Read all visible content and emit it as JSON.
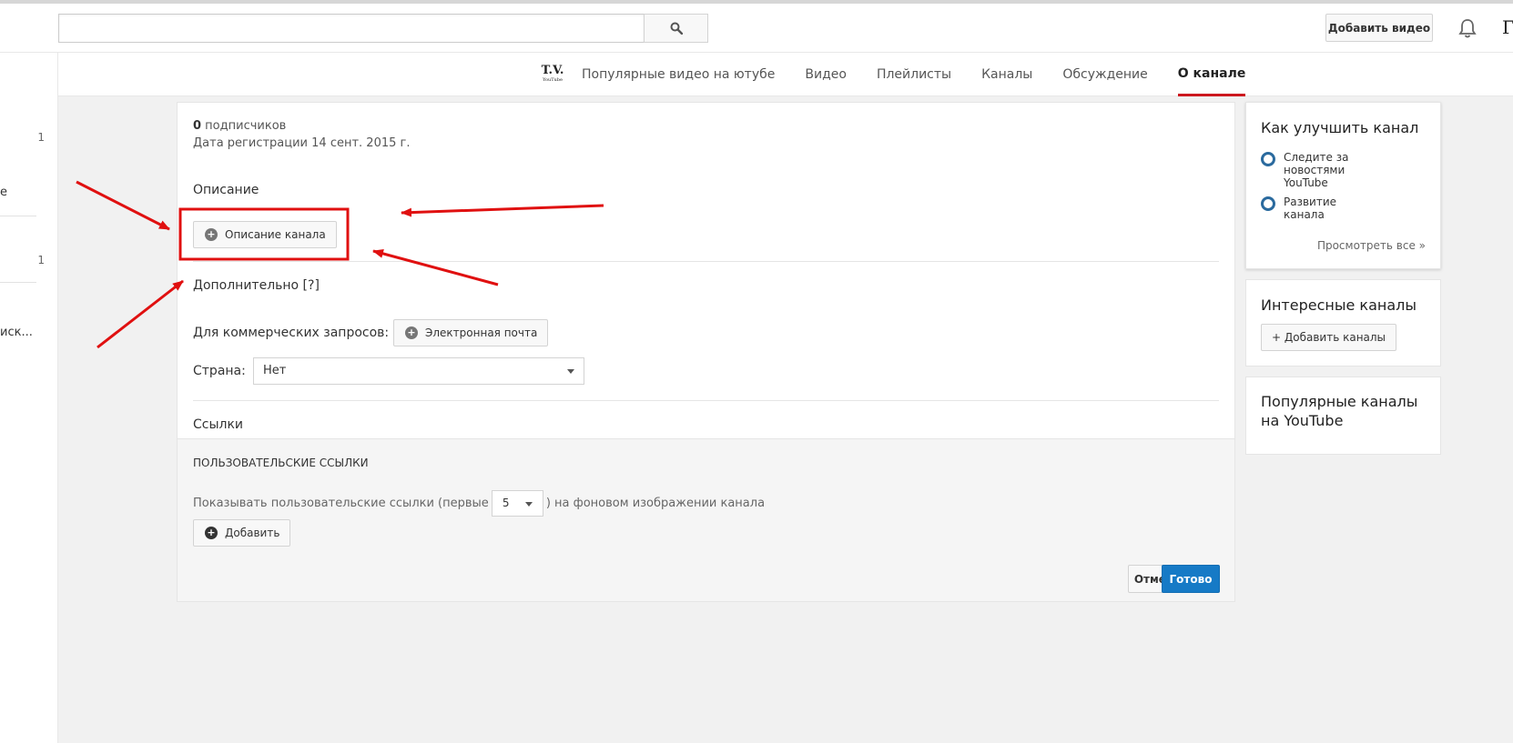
{
  "header": {
    "search": {
      "value": "",
      "placeholder": ""
    },
    "upload_label": "Добавить видео",
    "avatar_letter": "Г"
  },
  "leftnav": {
    "items": [
      {
        "fragment": "",
        "count": "1"
      },
      {
        "fragment": "е",
        "count": ""
      },
      {
        "fragment": "",
        "count": "1"
      },
      {
        "fragment": "иск...",
        "count": ""
      }
    ]
  },
  "channel": {
    "logo_line1": "T.V.",
    "logo_line2": "YouTube",
    "tabs": [
      {
        "label": "Популярные видео на ютубе"
      },
      {
        "label": "Видео"
      },
      {
        "label": "Плейлисты"
      },
      {
        "label": "Каналы"
      },
      {
        "label": "Обсуждение"
      },
      {
        "label": "О канале",
        "active": true
      }
    ]
  },
  "about": {
    "subscribers_count": "0",
    "subscribers_label": " подписчиков",
    "registration": "Дата регистрации 14 сент. 2015 г.",
    "description_title": "Описание",
    "description_button": "Описание канала",
    "additional_title": "Дополнительно [?]",
    "business_label": "Для коммерческих запросов:",
    "email_button": "Электронная почта",
    "country_label": "Страна:",
    "country_value": "Нет",
    "links_title": "Ссылки",
    "custom_links_caps": "ПОЛЬЗОВАТЕЛЬСКИЕ ССЫЛКИ",
    "show_links_before": "Показывать пользовательские ссылки (первые",
    "show_links_count": "5",
    "show_links_after": ") на фоновом изображении канала",
    "add_button": "Добавить",
    "cancel_button": "Отменить",
    "done_button": "Готово"
  },
  "sidebar": {
    "improve": {
      "title": "Как улучшить канал",
      "tips": [
        {
          "line1": "Следите за",
          "line2": "новостями",
          "line3": "YouTube"
        },
        {
          "line1": "Развитие",
          "line2": "канала",
          "line3": ""
        }
      ],
      "view_all": "Просмотреть все »"
    },
    "interesting": {
      "title": "Интересные каналы",
      "add_button": "+ Добавить каналы"
    },
    "popular": {
      "title_line1": "Популярные каналы",
      "title_line2": "на YouTube"
    }
  },
  "colors": {
    "annotation_red": "#e01010",
    "tab_active_underline": "#cc181e",
    "primary_button": "#167ac6",
    "ring": "#2a6a9e"
  }
}
